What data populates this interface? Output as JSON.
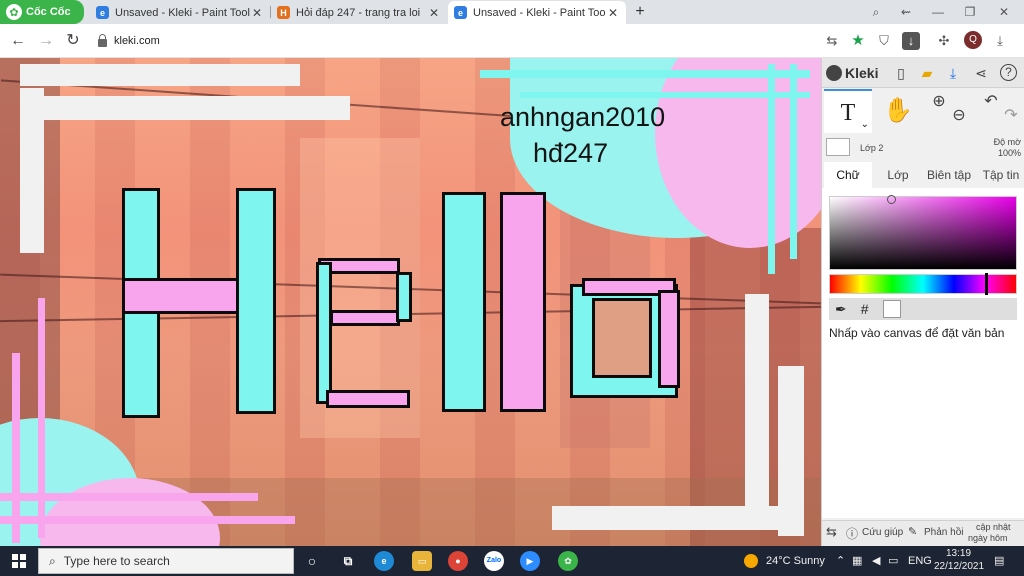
{
  "browser": {
    "brand": "Cốc Cốc",
    "tabs": [
      {
        "title": "Unsaved - Kleki - Paint Tool",
        "icon": "kleki-favicon",
        "active": false
      },
      {
        "title": "Hỏi đáp 247 - trang tra loi",
        "icon": "hoidap-favicon",
        "active": false
      },
      {
        "title": "Unsaved - Kleki - Paint Tool",
        "icon": "kleki-favicon",
        "active": true
      }
    ],
    "new_tab": "+",
    "url": "kleki.com",
    "profile_initial": "Q"
  },
  "canvas": {
    "text_line1": "anhngan2010",
    "text_line2": "hđ247",
    "colors": {
      "cyan": "#7ef5ee",
      "pink": "#f8a5ee",
      "white": "#f1f1f1"
    }
  },
  "kleki": {
    "logo": "Kleki",
    "tools": {
      "text_tool": "T",
      "hand_tool": "✋"
    },
    "layer": {
      "name": "Lớp 2",
      "opacity_label": "Độ mờ",
      "opacity_value": "100%"
    },
    "tabs": [
      "Chữ",
      "Lớp",
      "Biên tập",
      "Tập tin"
    ],
    "active_tab": "Chữ",
    "hex_symbol": "#",
    "hint": "Nhấp vào canvas để đặt văn bản",
    "footer": {
      "help": "Cứu giúp",
      "feedback": "Phản hồi",
      "update_line1": "cập nhật",
      "update_line2": "ngày hôm qua"
    }
  },
  "taskbar": {
    "search_placeholder": "Type here to search",
    "weather": "24°C  Sunny",
    "lang": "ENG",
    "time": "13:19",
    "date": "22/12/2021"
  }
}
